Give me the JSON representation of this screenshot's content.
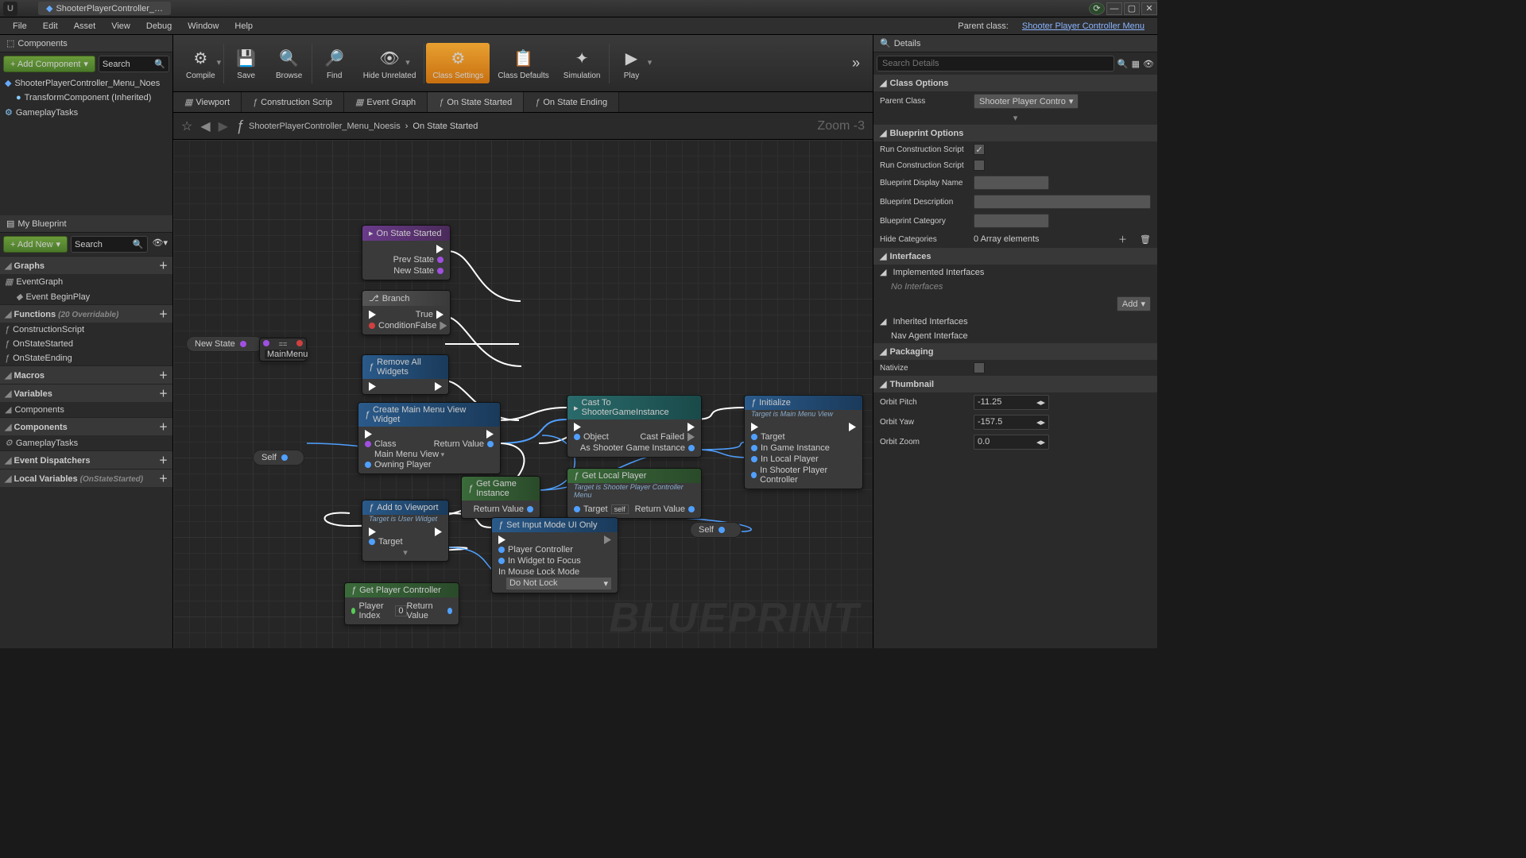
{
  "titlebar": {
    "tab": "ShooterPlayerController_…"
  },
  "menu": {
    "items": [
      "File",
      "Edit",
      "Asset",
      "View",
      "Debug",
      "Window",
      "Help"
    ],
    "parent_label": "Parent class:",
    "parent_class": "Shooter Player Controller Menu"
  },
  "components": {
    "title": "Components",
    "add": "+ Add Component",
    "search": "Search",
    "items": [
      "ShooterPlayerController_Menu_Noes",
      "TransformComponent (Inherited)",
      "GameplayTasks"
    ]
  },
  "myblueprint": {
    "title": "My Blueprint",
    "add": "+ Add New",
    "search": "Search",
    "sections": [
      {
        "name": "Graphs",
        "items": [
          "EventGraph",
          "Event BeginPlay"
        ]
      },
      {
        "name": "Functions",
        "suffix": "(20 Overridable)",
        "items": [
          "ConstructionScript",
          "OnStateStarted",
          "OnStateEnding"
        ]
      },
      {
        "name": "Macros",
        "items": []
      },
      {
        "name": "Variables",
        "items": []
      },
      {
        "name": "Components",
        "plain": true,
        "items": [
          "GameplayTasks"
        ]
      },
      {
        "name": "Event Dispatchers",
        "items": []
      },
      {
        "name": "Local Variables",
        "suffix": "(OnStateStarted)",
        "items": []
      }
    ]
  },
  "toolbar": {
    "items": [
      {
        "name": "compile",
        "label": "Compile",
        "icon": "⚙"
      },
      {
        "name": "save",
        "label": "Save",
        "icon": "💾"
      },
      {
        "name": "browse",
        "label": "Browse",
        "icon": "🔍"
      },
      {
        "name": "find",
        "label": "Find",
        "icon": "🔎"
      },
      {
        "name": "hide-unrelated",
        "label": "Hide Unrelated",
        "icon": "👁"
      },
      {
        "name": "class-settings",
        "label": "Class Settings",
        "icon": "⚙",
        "active": true
      },
      {
        "name": "class-defaults",
        "label": "Class Defaults",
        "icon": "📋"
      },
      {
        "name": "simulation",
        "label": "Simulation",
        "icon": "✦"
      },
      {
        "name": "play",
        "label": "Play",
        "icon": "▶"
      }
    ]
  },
  "tabs": [
    {
      "label": "Viewport",
      "icon": "▦"
    },
    {
      "label": "Construction Scrip",
      "icon": "ƒ"
    },
    {
      "label": "Event Graph",
      "icon": "▦"
    },
    {
      "label": "On State Started",
      "icon": "ƒ",
      "active": true
    },
    {
      "label": "On State Ending",
      "icon": "ƒ"
    }
  ],
  "breadcrumb": {
    "root": "ShooterPlayerController_Menu_Noesis",
    "leaf": "On State Started",
    "zoom": "Zoom -3"
  },
  "nodes": {
    "onstate": {
      "title": "On State Started",
      "pins": [
        "Prev State",
        "New State"
      ]
    },
    "branch": {
      "title": "Branch",
      "cond": "Condition",
      "t": "True",
      "f": "False"
    },
    "remove": {
      "title": "Remove All Widgets"
    },
    "create": {
      "title": "Create Main Menu View Widget",
      "class": "Class",
      "classval": "Main Menu View",
      "owning": "Owning Player",
      "ret": "Return Value"
    },
    "cast": {
      "title": "Cast To ShooterGameInstance",
      "obj": "Object",
      "fail": "Cast Failed",
      "as": "As Shooter Game Instance"
    },
    "init": {
      "title": "Initialize",
      "sub": "Target is Main Menu View",
      "tgt": "Target",
      "gi": "In Game Instance",
      "lp": "In Local Player",
      "spc": "In Shooter Player Controller"
    },
    "ggi": {
      "title": "Get Game Instance",
      "ret": "Return Value"
    },
    "glp": {
      "title": "Get Local Player",
      "sub": "Target is Shooter Player Controller Menu",
      "tgt": "Target",
      "self": "self",
      "ret": "Return Value"
    },
    "addvp": {
      "title": "Add to Viewport",
      "sub": "Target is User Widget",
      "tgt": "Target"
    },
    "setinput": {
      "title": "Set Input Mode UI Only",
      "pc": "Player Controller",
      "wf": "In Widget to Focus",
      "mlm": "In Mouse Lock Mode",
      "mlmval": "Do Not Lock"
    },
    "gpc": {
      "title": "Get Player Controller",
      "pi": "Player Index",
      "pival": "0",
      "ret": "Return Value"
    },
    "newstate": "New State",
    "mainmenu": "MainMenu",
    "self": "Self"
  },
  "details": {
    "title": "Details",
    "search": "Search Details",
    "class_options": {
      "title": "Class Options",
      "parent": "Parent Class",
      "parentval": "Shooter Player Contro"
    },
    "bp_options": {
      "title": "Blueprint Options",
      "rcs": "Run Construction Script",
      "rcs2": "Run Construction Script",
      "dn": "Blueprint Display Name",
      "desc": "Blueprint Description",
      "cat": "Blueprint Category",
      "hide": "Hide Categories",
      "hideval": "0 Array elements"
    },
    "interfaces": {
      "title": "Interfaces",
      "impl": "Implemented Interfaces",
      "none": "No Interfaces",
      "add": "Add",
      "inh": "Inherited Interfaces",
      "nav": "Nav Agent Interface"
    },
    "packaging": {
      "title": "Packaging",
      "nat": "Nativize"
    },
    "thumbnail": {
      "title": "Thumbnail",
      "pitch": "Orbit Pitch",
      "pitchv": "-11.25",
      "yaw": "Orbit Yaw",
      "yawv": "-157.5",
      "zoom": "Orbit Zoom",
      "zoomv": "0.0"
    }
  },
  "watermark": "BLUEPRINT"
}
